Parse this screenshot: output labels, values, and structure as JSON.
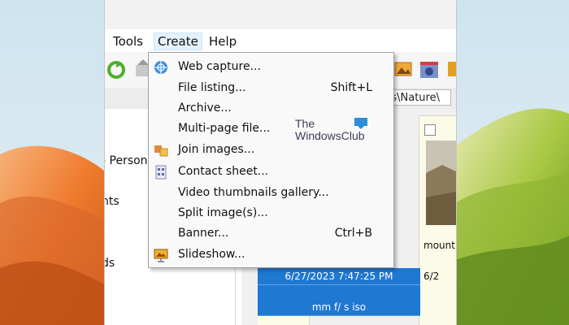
{
  "menubar": {
    "items": [
      {
        "label": "Tools"
      },
      {
        "label": "Create"
      },
      {
        "label": "Help"
      }
    ]
  },
  "address": {
    "path": "rs\\Nature\\"
  },
  "left_pane": {
    "items": [
      {
        "label": "- Person"
      },
      {
        "label": "nts"
      },
      {
        "label": "ds"
      }
    ]
  },
  "details": {
    "name_fragment": "mount",
    "date": "6/27/2023 7:47:25 PM",
    "date_fragment": "6/2",
    "exif": "mm f/ s iso"
  },
  "create_menu": {
    "items": [
      {
        "label": "Web capture...",
        "shortcut": "",
        "icon": "web-capture-icon"
      },
      {
        "label": "File listing...",
        "shortcut": "Shift+L",
        "icon": ""
      },
      {
        "label": "Archive...",
        "shortcut": "",
        "icon": ""
      },
      {
        "label": "Multi-page file...",
        "shortcut": "",
        "icon": ""
      },
      {
        "label": "Join images...",
        "shortcut": "",
        "icon": "join-images-icon"
      },
      {
        "label": "Contact sheet...",
        "shortcut": "",
        "icon": "contact-sheet-icon"
      },
      {
        "label": "Video thumbnails gallery...",
        "shortcut": "",
        "icon": ""
      },
      {
        "label": "Split image(s)...",
        "shortcut": "",
        "icon": ""
      },
      {
        "label": "Banner...",
        "shortcut": "Ctrl+B",
        "icon": ""
      },
      {
        "label": "Slideshow...",
        "shortcut": "",
        "icon": "slideshow-icon"
      }
    ]
  },
  "watermark": {
    "line1": "The",
    "line2": "WindowsClub"
  },
  "colors": {
    "accent": "#1f78d1",
    "menu_bg": "#f9f9f9",
    "wallpaper_orange": "#f08a3c",
    "wallpaper_green": "#9cc23a"
  }
}
